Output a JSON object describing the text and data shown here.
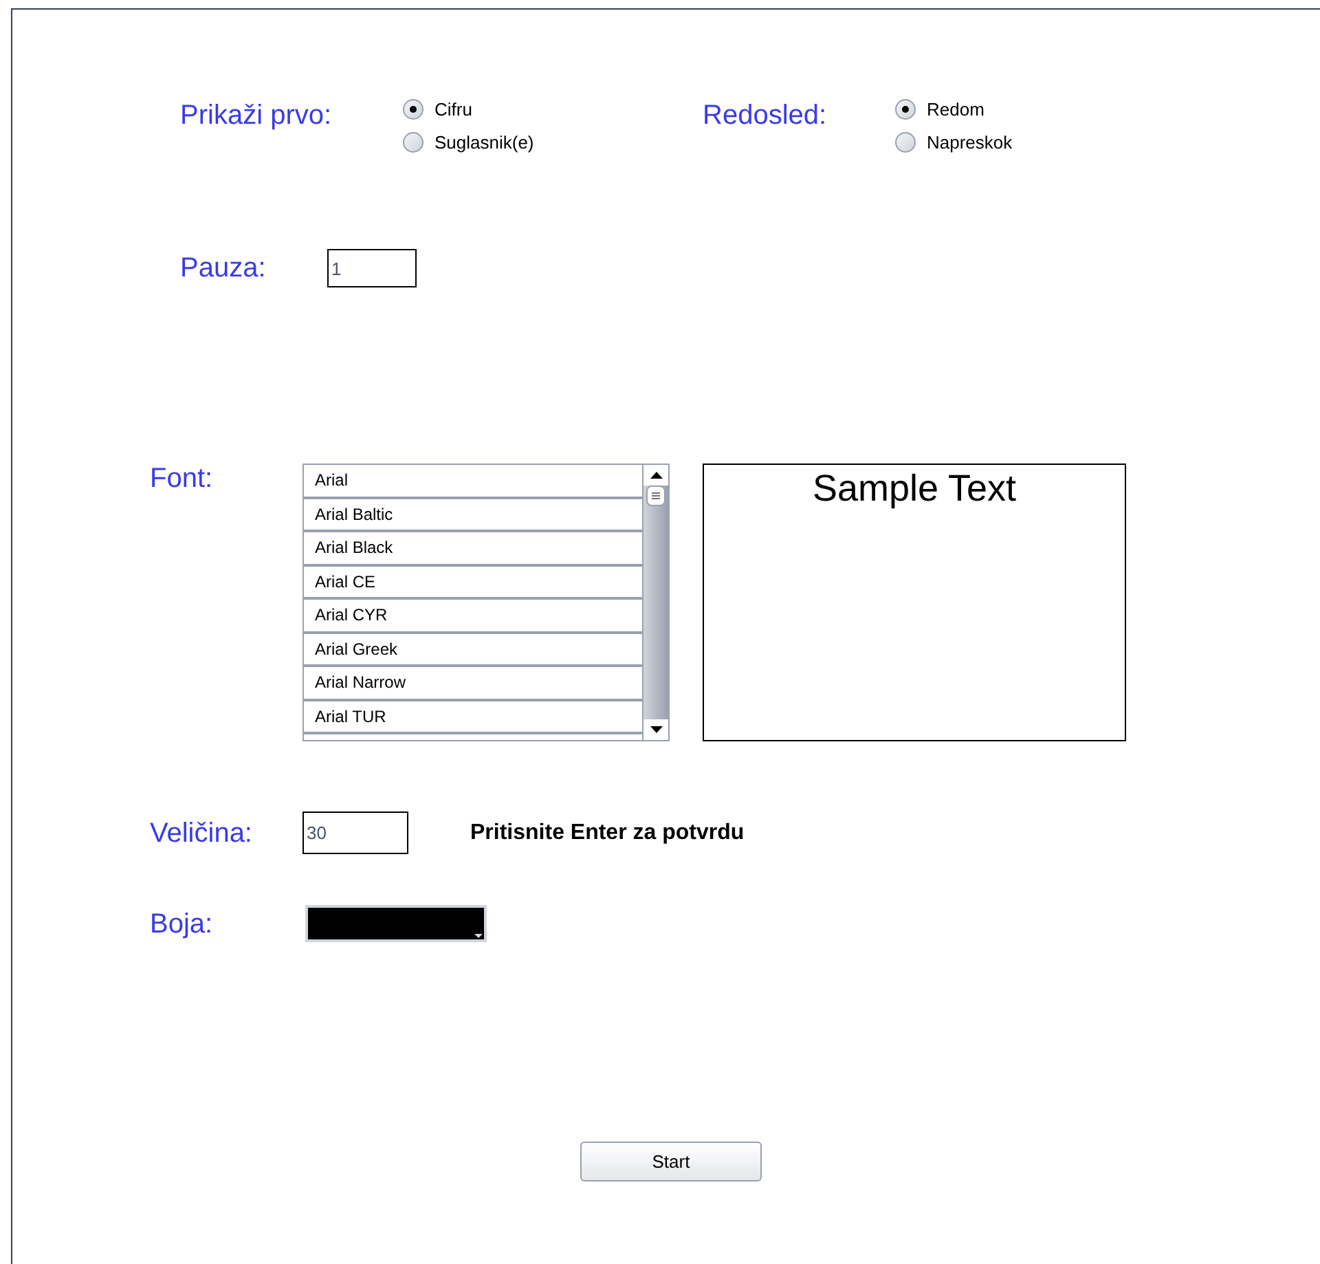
{
  "show_first": {
    "label": "Prikaži prvo:",
    "options": [
      {
        "label": "Cifru",
        "selected": true
      },
      {
        "label": "Suglasnik(e)",
        "selected": false
      }
    ]
  },
  "order": {
    "label": "Redosled:",
    "options": [
      {
        "label": "Redom",
        "selected": true
      },
      {
        "label": "Napreskok",
        "selected": false
      }
    ]
  },
  "pause": {
    "label": "Pauza:",
    "value": "1"
  },
  "font": {
    "label": "Font:",
    "items": [
      "Arial",
      "Arial Baltic",
      "Arial Black",
      "Arial CE",
      "Arial CYR",
      "Arial Greek",
      "Arial Narrow",
      "Arial TUR"
    ],
    "sample": "Sample Text"
  },
  "size": {
    "label": "Veličina:",
    "value": "30",
    "hint": "Pritisnite Enter za potvrdu"
  },
  "color": {
    "label": "Boja:",
    "color": "#000000"
  },
  "start_button": "Start"
}
